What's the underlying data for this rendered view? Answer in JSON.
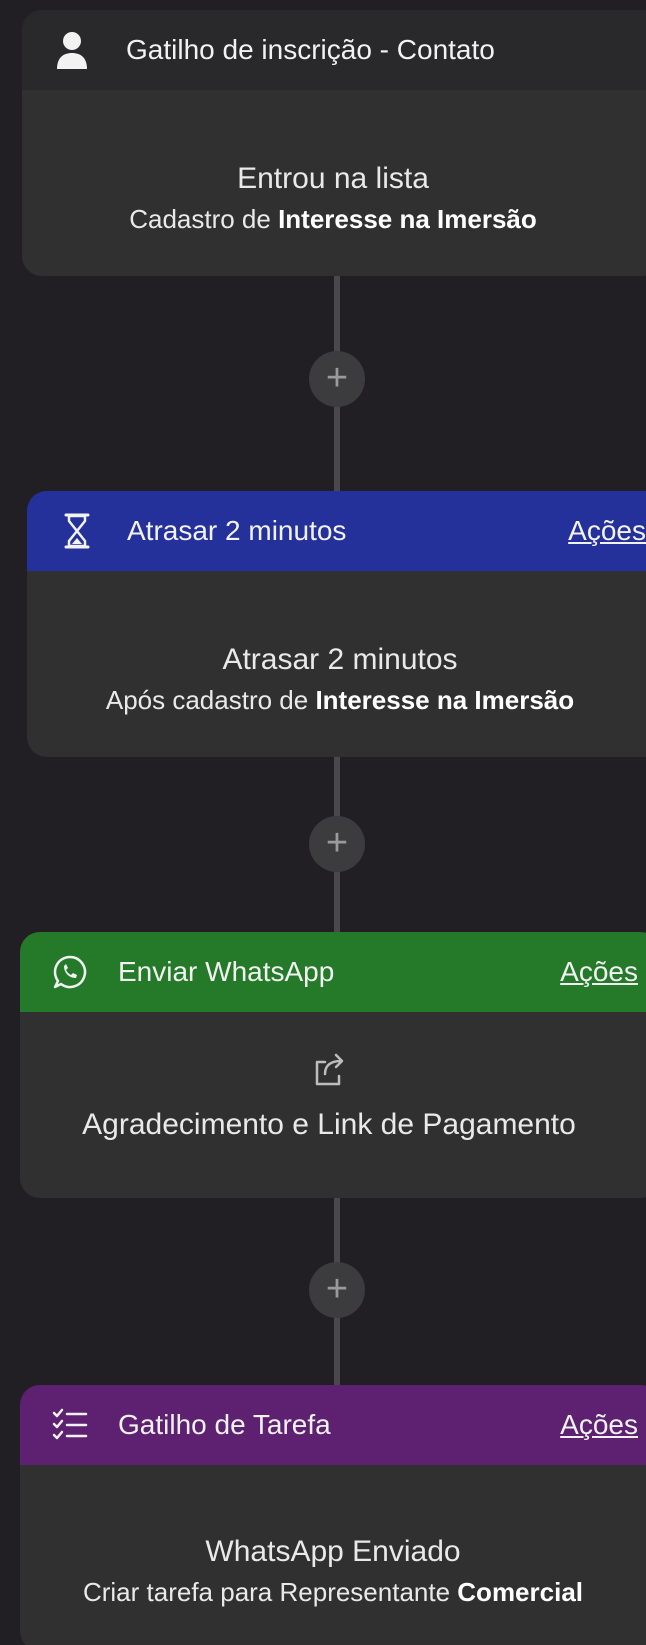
{
  "trigger": {
    "header": "Gatilho de inscrição - Contato",
    "line1": "Entrou na lista",
    "line2_prefix": "Cadastro de ",
    "line2_bold": "Interesse na Imersão"
  },
  "delay": {
    "header": "Atrasar 2 minutos",
    "actions": "Ações",
    "line1": "Atrasar 2 minutos",
    "line2_prefix": "Após cadastro de ",
    "line2_bold": "Interesse na Imersão"
  },
  "whatsapp": {
    "header": "Enviar WhatsApp",
    "actions": "Ações",
    "line1": "Agradecimento e Link de Pagamento"
  },
  "task": {
    "header": "Gatilho de Tarefa",
    "actions": "Ações",
    "line1": "WhatsApp Enviado",
    "line2_prefix": "Criar tarefa para Representante ",
    "line2_bold": "Comercial"
  },
  "add_step_symbol": "+",
  "colors": {
    "background": "#221f24",
    "card": "#303031",
    "header_contact": "#29282a",
    "header_delay": "#25319b",
    "header_whatsapp": "#257a29",
    "header_task": "#5e2070"
  },
  "icons": [
    "user-icon",
    "hourglass-icon",
    "whatsapp-icon",
    "share-icon",
    "checklist-icon",
    "plus-icon"
  ]
}
